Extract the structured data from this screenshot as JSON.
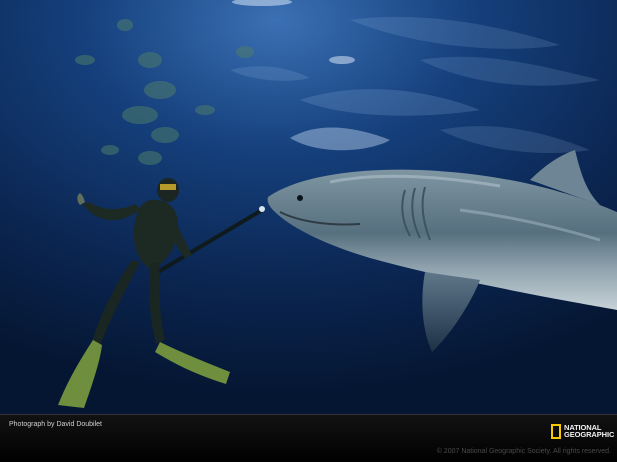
{
  "photo": {
    "subject": "great-white-shark-and-diver",
    "colors": {
      "water_deep": "#061a3a",
      "water_mid": "#0f3266",
      "surface_light": "#3b70b4",
      "shark_back": "#4f6675",
      "shark_belly": "#c8d3da",
      "diver_suit": "#1d2a24",
      "fins": "#6f8f3e"
    }
  },
  "caption": {
    "credit": "Photograph by David Doubilet",
    "copyright": "© 2007 National Geographic Society. All rights reserved."
  },
  "logo": {
    "line1": "NATIONAL",
    "line2": "GEOGRAPHIC",
    "accent": "#f6c900"
  }
}
